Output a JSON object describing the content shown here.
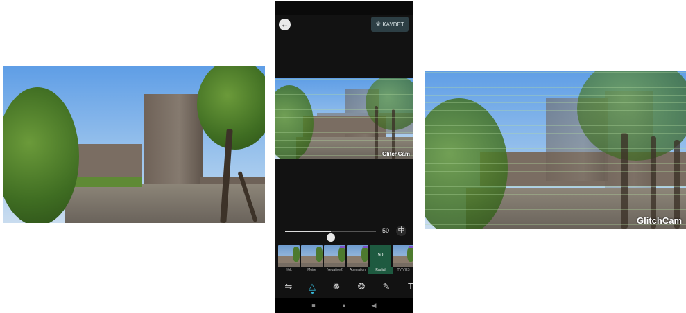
{
  "app_bar": {
    "back_icon": "arrow-left-icon",
    "save_label": "KAYDET",
    "save_icon": "crown-icon"
  },
  "watermark": "GlitchCam",
  "slider": {
    "value": 50,
    "value_label": "50",
    "min": 0,
    "max": 100,
    "compare_icon": "split-compare-icon"
  },
  "filters": [
    {
      "label": "Yok",
      "active": false
    },
    {
      "label": "Moire",
      "active": false
    },
    {
      "label": "Negative2",
      "active": false
    },
    {
      "label": "Aberration",
      "active": false
    },
    {
      "label": "Radial",
      "active": true,
      "value": "50"
    },
    {
      "label": "TV VHS",
      "active": false
    }
  ],
  "tools": [
    "adjust-sliders-icon",
    "triangle-effect-icon",
    "color-circles-icon",
    "aperture-icon",
    "brush-icon",
    "text-icon"
  ],
  "nav": [
    "square-icon",
    "circle-icon",
    "triangle-back-icon"
  ],
  "colors": {
    "accent": "#37b8d8",
    "active_filter": "#1e5a40",
    "save_button": "#2d3f45",
    "phone_bg": "#121212"
  }
}
